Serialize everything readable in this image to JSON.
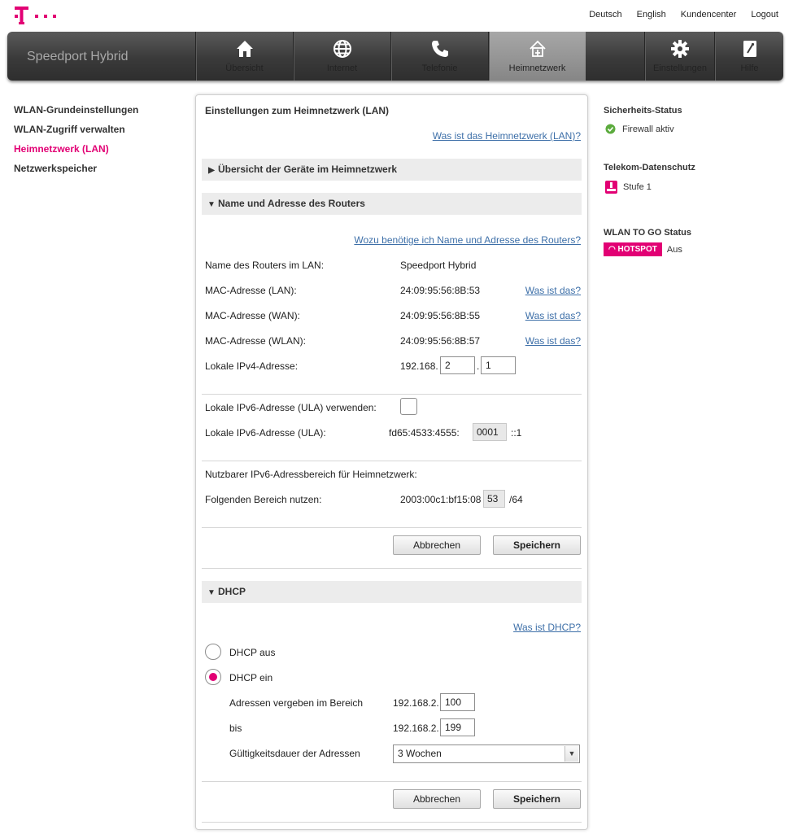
{
  "header": {
    "links": [
      "Deutsch",
      "English",
      "Kundencenter",
      "Logout"
    ]
  },
  "nav": {
    "brand": "Speedport Hybrid",
    "items": [
      {
        "label": "Übersicht",
        "icon": "home-icon"
      },
      {
        "label": "Internet",
        "icon": "globe-icon"
      },
      {
        "label": "Telefonie",
        "icon": "phone-icon"
      },
      {
        "label": "Heimnetzwerk",
        "icon": "home-network-icon",
        "active": true
      },
      {
        "label": "Einstellungen",
        "icon": "gear-icon"
      },
      {
        "label": "Hilfe",
        "icon": "help-book-icon"
      }
    ]
  },
  "sidebar": {
    "items": [
      {
        "label": "WLAN-Grundeinstellungen"
      },
      {
        "label": "WLAN-Zugriff verwalten"
      },
      {
        "label": "Heimnetzwerk (LAN)",
        "active": true
      },
      {
        "label": "Netzwerkspeicher"
      }
    ]
  },
  "right": {
    "security_title": "Sicherheits-Status",
    "security_value": "Firewall aktiv",
    "privacy_title": "Telekom-Datenschutz",
    "privacy_value": "Stufe 1",
    "wlantogo_title": "WLAN TO GO Status",
    "hotspot_badge": "HOTSPOT",
    "hotspot_value": "Aus"
  },
  "main": {
    "title": "Einstellungen zum Heimnetzwerk (LAN)",
    "help_link": "Was ist das Heimnetzwerk (LAN)?",
    "sections": {
      "overview": "Übersicht der Geräte im Heimnetzwerk",
      "router": "Name und Adresse des Routers",
      "dhcp": "DHCP"
    },
    "router": {
      "help_link": "Wozu benötige ich Name und Adresse des Routers?",
      "name_label": "Name des Routers im LAN:",
      "name_value": "Speedport Hybrid",
      "mac_lan_label": "MAC-Adresse (LAN):",
      "mac_lan_value": "24:09:95:56:8B:53",
      "mac_wan_label": "MAC-Adresse (WAN):",
      "mac_wan_value": "24:09:95:56:8B:55",
      "mac_wlan_label": "MAC-Adresse (WLAN):",
      "mac_wlan_value": "24:09:95:56:8B:57",
      "what_is_that": "Was ist das?",
      "ipv4_label": "Lokale IPv4-Adresse:",
      "ipv4_prefix": "192.168.",
      "ipv4_third": "2",
      "ipv4_dot": ".",
      "ipv4_fourth": "1",
      "ula_use_label": "Lokale IPv6-Adresse (ULA) verwenden:",
      "ula_label": "Lokale IPv6-Adresse (ULA):",
      "ula_prefix": "fd65:4533:4555:",
      "ula_box": "0001",
      "ula_suffix": "::1",
      "range_heading": "Nutzbarer IPv6-Adressbereich für Heimnetzwerk:",
      "range_label": "Folgenden Bereich nutzen:",
      "range_prefix": "2003:00c1:bf15:08",
      "range_box": "53",
      "range_suffix": "/64"
    },
    "buttons": {
      "cancel": "Abbrechen",
      "save": "Speichern"
    },
    "dhcp": {
      "help_link": "Was ist DHCP?",
      "off_label": "DHCP aus",
      "on_label": "DHCP ein",
      "range_label": "Adressen vergeben im Bereich",
      "range_prefix": "192.168.2.",
      "range_start": "100",
      "to_label": "bis",
      "to_prefix": "192.168.2.",
      "range_end": "199",
      "lease_label": "Gültigkeitsdauer der Adressen",
      "lease_value": "3 Wochen"
    }
  },
  "colors": {
    "brand_magenta": "#e20074",
    "link_blue": "#3d6fa8",
    "status_green": "#5cab3e"
  }
}
